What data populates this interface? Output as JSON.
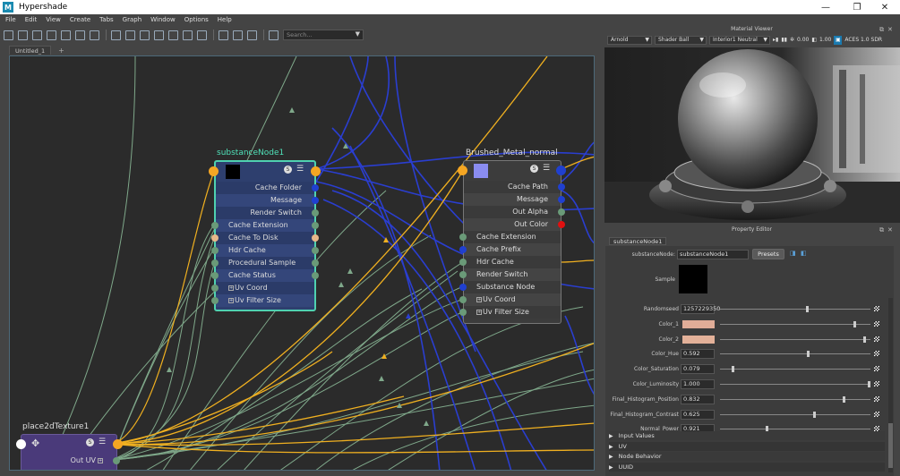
{
  "app": {
    "title": "Hypershade",
    "logo": "M"
  },
  "window_controls": {
    "minimize": "—",
    "maximize": "❐",
    "close": "✕"
  },
  "menu": [
    "File",
    "Edit",
    "View",
    "Create",
    "Tabs",
    "Graph",
    "Window",
    "Options",
    "Help"
  ],
  "toolbar": {
    "search_placeholder": "Search..."
  },
  "tabs": [
    {
      "label": "Untitled_1"
    }
  ],
  "tab_add": "+",
  "graph": {
    "substance_node": {
      "title": "substanceNode1",
      "header_s": "S",
      "rows": [
        "Cache Folder",
        "Message",
        "Render Switch",
        "Cache Extension",
        "Cache To Disk",
        "Hdr Cache Extension",
        "Procedural Sample Rate",
        "Cache Status",
        "Uv Coord",
        "Uv Filter Size"
      ]
    },
    "brushed_node": {
      "title": "Brushed_Metal_normal",
      "header_s": "S",
      "rows": [
        "Cache Path",
        "Message",
        "Out Alpha",
        "Out Color",
        "Cache Extension",
        "Cache Prefix",
        "Hdr Cache Extension",
        "Render Switch",
        "Substance Node",
        "Uv Coord",
        "Uv Filter Size"
      ]
    },
    "place_node": {
      "title": "place2dTexture1",
      "header_s": "S",
      "rows": [
        "Out UV"
      ]
    }
  },
  "material_viewer": {
    "title": "Material Viewer",
    "renderer": "Arnold",
    "shape": "Shader Ball",
    "environment": "Interior1 Neutral",
    "exposure": "0.00",
    "gamma": "1.00",
    "color_space": "ACES 1.0 SDR"
  },
  "property_editor": {
    "title": "Property Editor",
    "tab": "substanceNode1",
    "node_label": "substanceNode:",
    "node_value": "substanceNode1",
    "presets_label": "Presets",
    "sample_label": "Sample",
    "attributes": [
      {
        "label": "Randomseed",
        "value": "1257229350",
        "slider": 0.58
      },
      {
        "label": "Color_1",
        "swatch": "#e0ad98",
        "slider": 0.9
      },
      {
        "label": "Color_2",
        "swatch": "#e3b199",
        "slider": 0.97
      },
      {
        "label": "Color_Hue",
        "value": "0.592",
        "slider": 0.59
      },
      {
        "label": "Color_Saturation",
        "value": "0.079",
        "slider": 0.08
      },
      {
        "label": "Color_Luminosity",
        "value": "1.000",
        "slider": 1.0
      },
      {
        "label": "Final_Histogram_Position",
        "value": "0.832",
        "slider": 0.83
      },
      {
        "label": "Final_Histogram_Contrast",
        "value": "0.625",
        "slider": 0.63
      },
      {
        "label": "Normal_Power",
        "value": "0.921",
        "slider": 0.31
      }
    ],
    "sections": [
      "Input Values",
      "UV",
      "Node Behavior",
      "UUID"
    ]
  },
  "colors": {
    "substance_border": "#4fd1b0",
    "substance_body": "#2e3f6e",
    "brushed_body": "#3c3c3c",
    "place_body": "#4a3a7a",
    "port_orange": "#f5a623",
    "port_blue": "#2040d0",
    "port_green": "#6a9a78",
    "port_red": "#e01010",
    "wire_yellow": "#f0b020",
    "wire_blue": "#2a3ed0",
    "wire_green": "#7fa88a"
  }
}
